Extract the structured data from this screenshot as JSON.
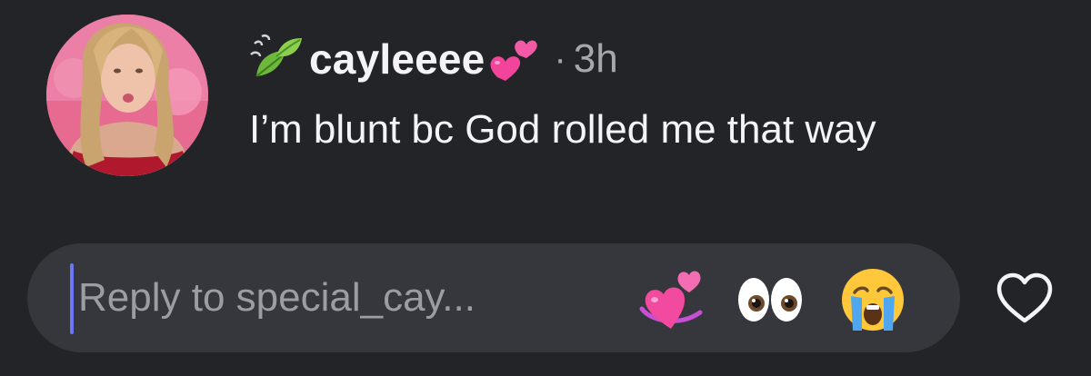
{
  "comment": {
    "username": "cayleeee",
    "leading_badge_icon": "green-leaves-icon",
    "trailing_badge_icon": "two-hearts-icon",
    "dot": "·",
    "timestamp": "3h",
    "text": "I’m blunt bc God rolled me that way"
  },
  "avatar": {
    "icon": "profile-photo"
  },
  "reply": {
    "placeholder": "Reply to special_cay...",
    "quick_reactions": [
      "revolving-hearts-icon",
      "eyes-icon",
      "crying-face-icon"
    ],
    "like_icon": "heart-outline-icon"
  },
  "colors": {
    "background": "#232428",
    "reply_bar": "#36373c",
    "secondary_text": "#a7a8ad",
    "caret": "#6a76f5",
    "heart_pink": "#f2449a"
  }
}
